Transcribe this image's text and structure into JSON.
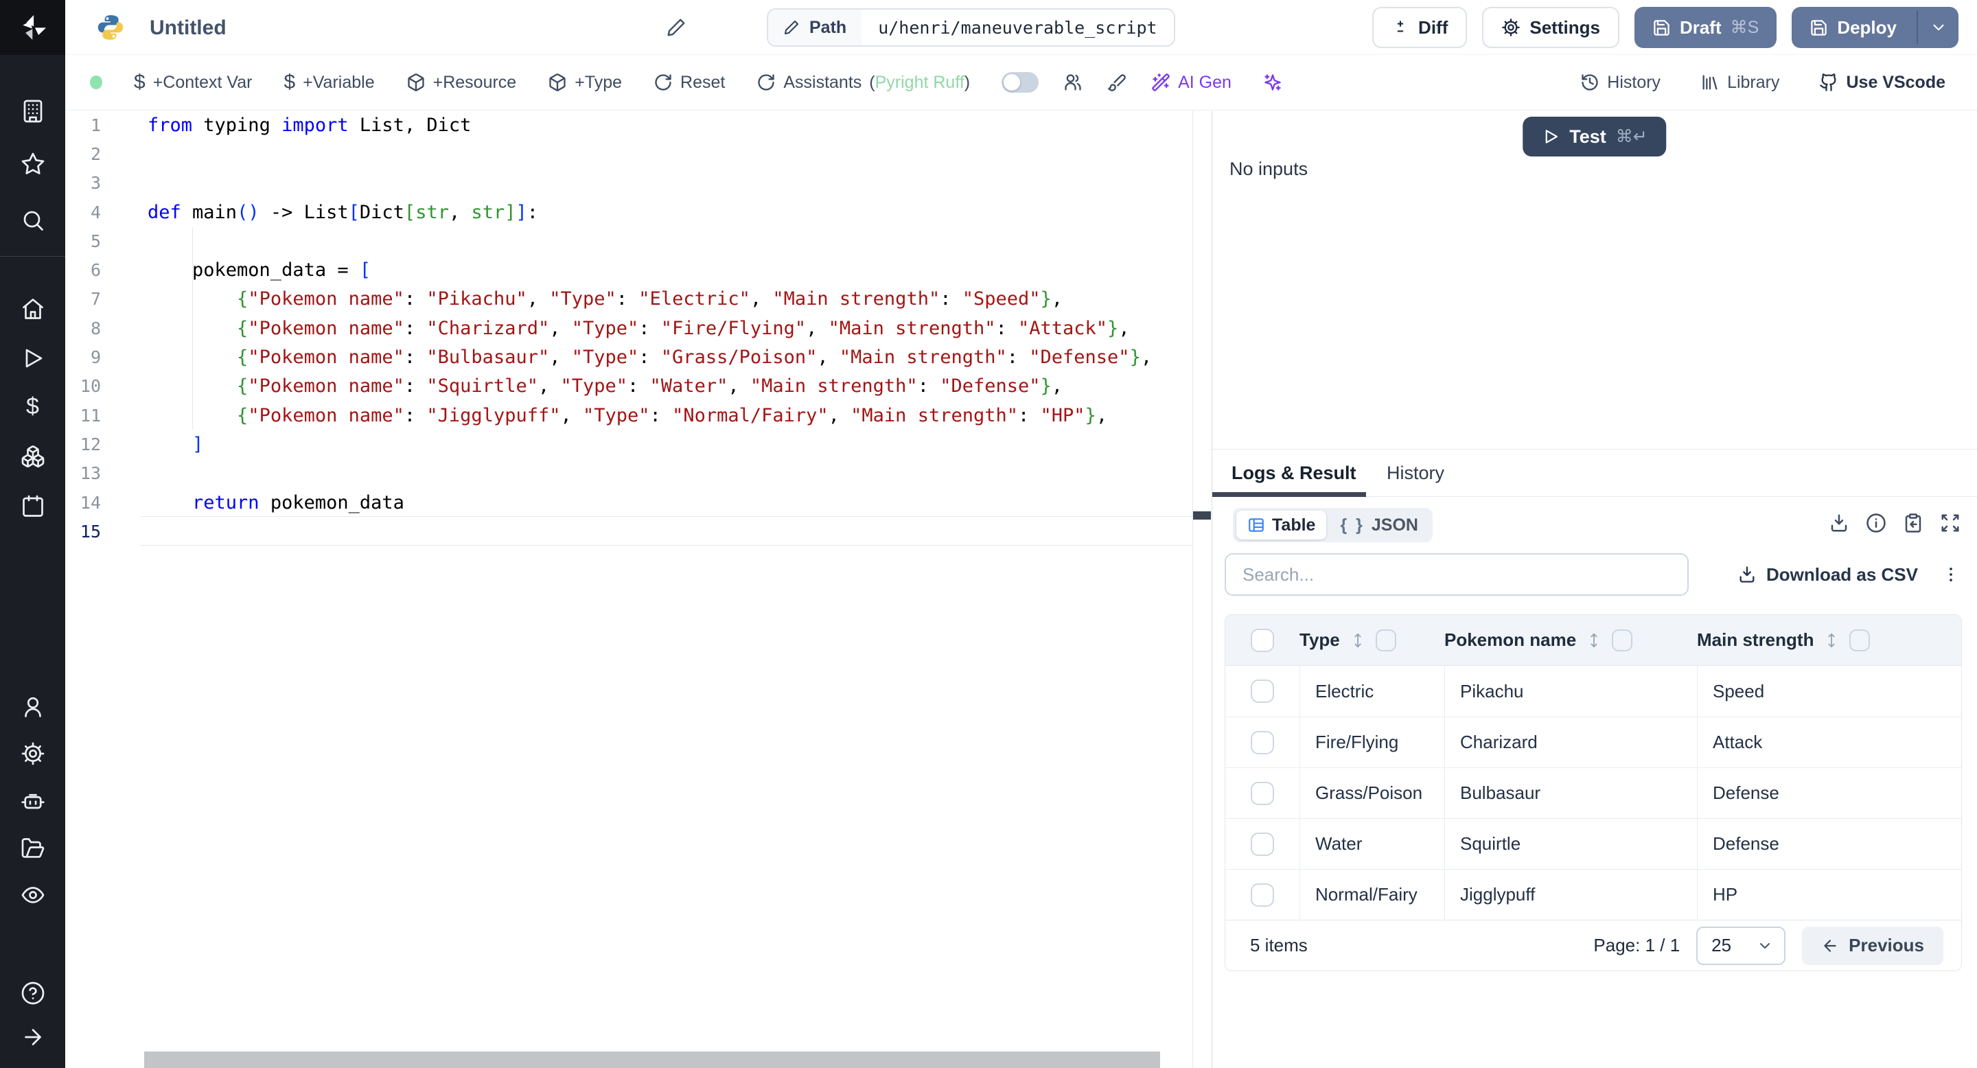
{
  "topbar": {
    "title": "Untitled",
    "path": {
      "label": "Path",
      "value": "u/henri/maneuverable_script"
    },
    "buttons": {
      "diff": "Diff",
      "settings": "Settings",
      "draft": "Draft",
      "draft_shortcut": "⌘S",
      "deploy": "Deploy"
    }
  },
  "toolbar": {
    "add_context_var": "+Context Var",
    "add_variable": "+Variable",
    "add_resource": "+Resource",
    "add_type": "+Type",
    "reset": "Reset",
    "assistants": "Assistants",
    "assistants_status_open": "(",
    "assistants_status": "Pyright Ruff",
    "assistants_status_close": ")",
    "ai_gen": "AI Gen",
    "history": "History",
    "library": "Library",
    "use_vscode": "Use VScode"
  },
  "editor": {
    "lines": [
      {
        "n": "1",
        "tokens": [
          [
            "kw",
            "from"
          ],
          [
            "pl",
            " typing "
          ],
          [
            "kw",
            "import"
          ],
          [
            "pl",
            " List, Dict"
          ]
        ]
      },
      {
        "n": "2",
        "tokens": []
      },
      {
        "n": "3",
        "tokens": []
      },
      {
        "n": "4",
        "tokens": [
          [
            "kw",
            "def"
          ],
          [
            "pl",
            " main"
          ],
          [
            "b1",
            "()"
          ],
          [
            "pl",
            " -> List"
          ],
          [
            "b1",
            "["
          ],
          [
            "pl",
            "Dict"
          ],
          [
            "b2",
            "["
          ],
          [
            "ty",
            "str"
          ],
          [
            "pl",
            ", "
          ],
          [
            "ty",
            "str"
          ],
          [
            "b2",
            "]"
          ],
          [
            "b1",
            "]"
          ],
          [
            "pl",
            ":"
          ]
        ]
      },
      {
        "n": "5",
        "tokens": []
      },
      {
        "n": "6",
        "tokens": [
          [
            "pl",
            "    pokemon_data = "
          ],
          [
            "b1",
            "["
          ]
        ]
      },
      {
        "n": "7",
        "tokens": [
          [
            "pl",
            "        "
          ],
          [
            "b2",
            "{"
          ],
          [
            "st",
            "\"Pokemon name\""
          ],
          [
            "pl",
            ": "
          ],
          [
            "st",
            "\"Pikachu\""
          ],
          [
            "pl",
            ", "
          ],
          [
            "st",
            "\"Type\""
          ],
          [
            "pl",
            ": "
          ],
          [
            "st",
            "\"Electric\""
          ],
          [
            "pl",
            ", "
          ],
          [
            "st",
            "\"Main strength\""
          ],
          [
            "pl",
            ": "
          ],
          [
            "st",
            "\"Speed\""
          ],
          [
            "b2",
            "}"
          ],
          [
            "pl",
            ","
          ]
        ]
      },
      {
        "n": "8",
        "tokens": [
          [
            "pl",
            "        "
          ],
          [
            "b2",
            "{"
          ],
          [
            "st",
            "\"Pokemon name\""
          ],
          [
            "pl",
            ": "
          ],
          [
            "st",
            "\"Charizard\""
          ],
          [
            "pl",
            ", "
          ],
          [
            "st",
            "\"Type\""
          ],
          [
            "pl",
            ": "
          ],
          [
            "st",
            "\"Fire/Flying\""
          ],
          [
            "pl",
            ", "
          ],
          [
            "st",
            "\"Main strength\""
          ],
          [
            "pl",
            ": "
          ],
          [
            "st",
            "\"Attack\""
          ],
          [
            "b2",
            "}"
          ],
          [
            "pl",
            ","
          ]
        ]
      },
      {
        "n": "9",
        "tokens": [
          [
            "pl",
            "        "
          ],
          [
            "b2",
            "{"
          ],
          [
            "st",
            "\"Pokemon name\""
          ],
          [
            "pl",
            ": "
          ],
          [
            "st",
            "\"Bulbasaur\""
          ],
          [
            "pl",
            ", "
          ],
          [
            "st",
            "\"Type\""
          ],
          [
            "pl",
            ": "
          ],
          [
            "st",
            "\"Grass/Poison\""
          ],
          [
            "pl",
            ", "
          ],
          [
            "st",
            "\"Main strength\""
          ],
          [
            "pl",
            ": "
          ],
          [
            "st",
            "\"Defense\""
          ],
          [
            "b2",
            "}"
          ],
          [
            "pl",
            ","
          ]
        ]
      },
      {
        "n": "10",
        "tokens": [
          [
            "pl",
            "        "
          ],
          [
            "b2",
            "{"
          ],
          [
            "st",
            "\"Pokemon name\""
          ],
          [
            "pl",
            ": "
          ],
          [
            "st",
            "\"Squirtle\""
          ],
          [
            "pl",
            ", "
          ],
          [
            "st",
            "\"Type\""
          ],
          [
            "pl",
            ": "
          ],
          [
            "st",
            "\"Water\""
          ],
          [
            "pl",
            ", "
          ],
          [
            "st",
            "\"Main strength\""
          ],
          [
            "pl",
            ": "
          ],
          [
            "st",
            "\"Defense\""
          ],
          [
            "b2",
            "}"
          ],
          [
            "pl",
            ","
          ]
        ]
      },
      {
        "n": "11",
        "tokens": [
          [
            "pl",
            "        "
          ],
          [
            "b2",
            "{"
          ],
          [
            "st",
            "\"Pokemon name\""
          ],
          [
            "pl",
            ": "
          ],
          [
            "st",
            "\"Jigglypuff\""
          ],
          [
            "pl",
            ", "
          ],
          [
            "st",
            "\"Type\""
          ],
          [
            "pl",
            ": "
          ],
          [
            "st",
            "\"Normal/Fairy\""
          ],
          [
            "pl",
            ", "
          ],
          [
            "st",
            "\"Main strength\""
          ],
          [
            "pl",
            ": "
          ],
          [
            "st",
            "\"HP\""
          ],
          [
            "b2",
            "}"
          ],
          [
            "pl",
            ","
          ]
        ]
      },
      {
        "n": "12",
        "tokens": [
          [
            "pl",
            "    "
          ],
          [
            "b1",
            "]"
          ]
        ]
      },
      {
        "n": "13",
        "tokens": []
      },
      {
        "n": "14",
        "tokens": [
          [
            "pl",
            "    "
          ],
          [
            "kw",
            "return"
          ],
          [
            "pl",
            " pokemon_data"
          ]
        ]
      },
      {
        "n": "15",
        "tokens": [],
        "active": true
      }
    ]
  },
  "run_panel": {
    "test": "Test",
    "test_shortcut": "⌘↵",
    "no_inputs": "No inputs"
  },
  "results_panel": {
    "tabs": [
      {
        "label": "Logs & Result",
        "active": true
      },
      {
        "label": "History",
        "active": false
      }
    ],
    "view_modes": [
      {
        "label": "Table",
        "active": true
      },
      {
        "label": "JSON",
        "active": false
      }
    ],
    "braces_glyph": "{ }",
    "search_placeholder": "Search...",
    "download_csv": "Download as CSV",
    "table": {
      "columns": [
        "Type",
        "Pokemon name",
        "Main strength"
      ],
      "rows": [
        [
          "Electric",
          "Pikachu",
          "Speed"
        ],
        [
          "Fire/Flying",
          "Charizard",
          "Attack"
        ],
        [
          "Grass/Poison",
          "Bulbasaur",
          "Defense"
        ],
        [
          "Water",
          "Squirtle",
          "Defense"
        ],
        [
          "Normal/Fairy",
          "Jigglypuff",
          "HP"
        ]
      ]
    },
    "footer": {
      "items": "5 items",
      "page": "Page: 1 / 1",
      "page_size": "25",
      "previous": "Previous"
    }
  },
  "colors": {
    "primary_button": "#63769b",
    "test_button": "#37465f",
    "ai_purple": "#7c3aed",
    "status_green": "#8fe3ad",
    "table_icon_blue": "#3c83f6",
    "sidebar_bg": "#1b1e24"
  }
}
